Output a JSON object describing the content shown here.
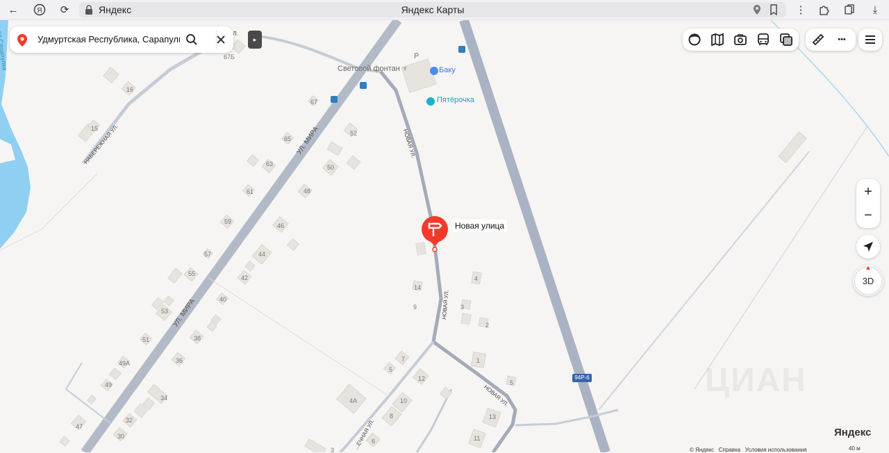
{
  "browser": {
    "domain": "Яндекс",
    "title": "Яндекс Карты"
  },
  "search": {
    "query": "Удмуртская Республика, Сарапульск"
  },
  "marker": {
    "label": "Новая улица",
    "color": "#f33a2a"
  },
  "pois": {
    "fountain": "Световой фонтан",
    "baku": "Баку",
    "pyaterochka": "Пятёрочка",
    "parking": "P"
  },
  "streets": {
    "mira_1": "УЛ. МИРА",
    "mira_2": "УЛ. МИРА",
    "novaya_1": "НОВАЯ УЛ.",
    "novaya_2": "НОВАЯ УЛ.",
    "novaya_3": "НОВАЯ УЛ.",
    "novaya_4": "НОВАЯ УЛ.",
    "naberezhnaya": "НАБЕРЕЖНАЯ УЛ.",
    "rechnaya": "...ЕЧНАЯ УЛ.",
    "river": "...ая Сарапулка",
    "highway": "94Р-6"
  },
  "house_numbers": [
    "67Б",
    "16",
    "67",
    "15",
    "65",
    "52",
    "63",
    "50",
    "61",
    "48",
    "59",
    "46",
    "57",
    "44",
    "55",
    "42",
    "40",
    "53",
    "38",
    "51",
    "36",
    "49А",
    "49",
    "34",
    "47",
    "32",
    "30",
    "14",
    "4",
    "9",
    "3",
    "2",
    "1",
    "7",
    "5",
    "12",
    "10",
    "4А",
    "8",
    "5",
    "13",
    "11",
    "6",
    "3"
  ],
  "controls": {
    "zoom_in": "+",
    "zoom_out": "−",
    "three_d": "3D",
    "more": "•••"
  },
  "footer": {
    "copyright": "© Яндекс",
    "help": "Справка",
    "terms": "Условия использования",
    "logo": "Яндекс",
    "scale": "40 м"
  },
  "colors": {
    "land": "#f6f5f3",
    "water": "#8fd0f2",
    "major_road": "#b6bdcb",
    "minor_road": "#c3c9d4",
    "building": "#e6e3df",
    "transit": "#2f7fc1",
    "accent": "#f33a2a"
  }
}
